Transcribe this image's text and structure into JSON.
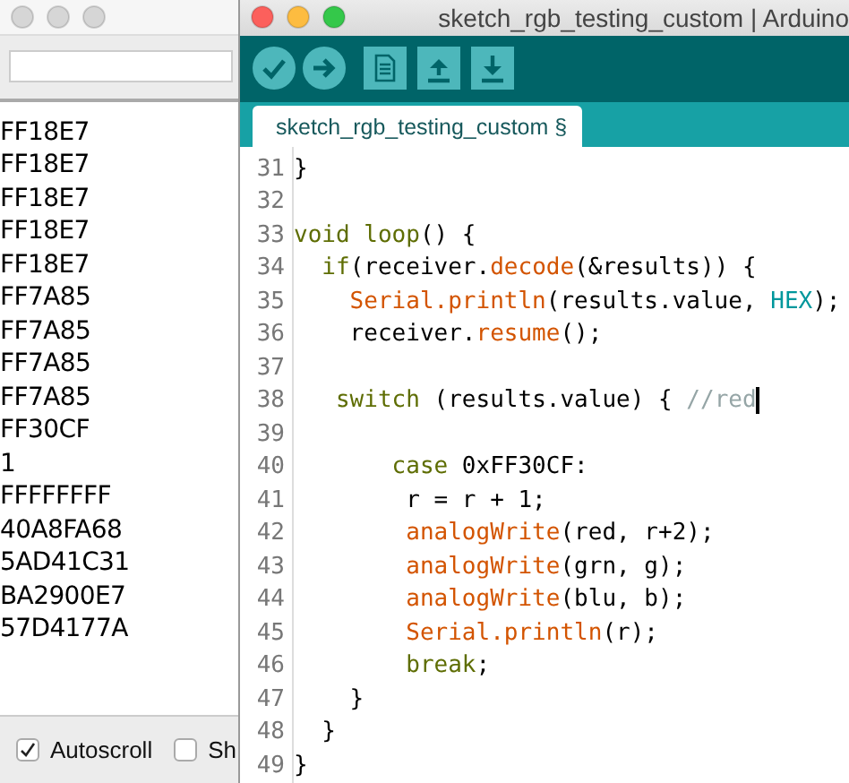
{
  "serial_monitor": {
    "output": [
      "FF18E7",
      "FF18E7",
      "FF18E7",
      "FF18E7",
      "FF18E7",
      "FF7A85",
      "FF7A85",
      "FF7A85",
      "FF7A85",
      "FF30CF",
      "1",
      "FFFFFFFF",
      "40A8FA68",
      "5AD41C31",
      "BA2900E7",
      "57D4177A"
    ],
    "options": [
      {
        "label": "Autoscroll",
        "checked": true
      },
      {
        "label": "Sh",
        "checked": false
      }
    ]
  },
  "ide": {
    "window": {
      "title": "sketch_rgb_testing_custom | Arduino"
    },
    "tabs": [
      {
        "label": "sketch_rgb_testing_custom §",
        "selected": true
      }
    ],
    "lines": [
      {
        "number": "31",
        "cursor": false,
        "segments": [
          {
            "kind": "plain",
            "text": "}"
          }
        ]
      },
      {
        "number": "32",
        "cursor": false
      },
      {
        "number": "33",
        "cursor": false,
        "segments": [
          {
            "kind": "keyword",
            "text": "void loop"
          },
          {
            "kind": "plain",
            "text": "() {"
          }
        ]
      },
      {
        "number": "34",
        "cursor": false,
        "segments": [
          {
            "kind": "keyword",
            "text": "  if"
          },
          {
            "kind": "plain",
            "text": "(receiver."
          },
          {
            "kind": "function",
            "text": "decode"
          },
          {
            "kind": "plain",
            "text": "(&results)) {"
          }
        ]
      },
      {
        "number": "35",
        "cursor": false,
        "segments": [
          {
            "kind": "function",
            "text": "    Serial.println"
          },
          {
            "kind": "plain",
            "text": "(results.value, "
          },
          {
            "kind": "constant",
            "text": "HEX"
          },
          {
            "kind": "plain",
            "text": ");"
          }
        ]
      },
      {
        "number": "36",
        "cursor": false,
        "segments": [
          {
            "kind": "plain",
            "text": "    receiver."
          },
          {
            "kind": "function",
            "text": "resume"
          },
          {
            "kind": "plain",
            "text": "();"
          }
        ]
      },
      {
        "number": "37",
        "cursor": false
      },
      {
        "number": "38",
        "cursor": true,
        "segments": [
          {
            "kind": "keyword",
            "text": "   switch"
          },
          {
            "kind": "plain",
            "text": " (results.value) { "
          },
          {
            "kind": "comment",
            "text": "//red"
          }
        ]
      },
      {
        "number": "39",
        "cursor": false
      },
      {
        "number": "40",
        "cursor": false,
        "segments": [
          {
            "kind": "keyword",
            "text": "       case"
          },
          {
            "kind": "plain",
            "text": " 0xFF30CF:"
          }
        ]
      },
      {
        "number": "41",
        "cursor": false,
        "segments": [
          {
            "kind": "plain",
            "text": "        r = r + 1;"
          }
        ]
      },
      {
        "number": "42",
        "cursor": false,
        "segments": [
          {
            "kind": "function",
            "text": "        analogWrite"
          },
          {
            "kind": "plain",
            "text": "(red, r+2);"
          }
        ]
      },
      {
        "number": "43",
        "cursor": false,
        "segments": [
          {
            "kind": "function",
            "text": "        analogWrite"
          },
          {
            "kind": "plain",
            "text": "(grn, g);"
          }
        ]
      },
      {
        "number": "44",
        "cursor": false,
        "segments": [
          {
            "kind": "function",
            "text": "        analogWrite"
          },
          {
            "kind": "plain",
            "text": "(blu, b);"
          }
        ]
      },
      {
        "number": "45",
        "cursor": false,
        "segments": [
          {
            "kind": "function",
            "text": "        Serial.println"
          },
          {
            "kind": "plain",
            "text": "(r);"
          }
        ]
      },
      {
        "number": "46",
        "cursor": false,
        "segments": [
          {
            "kind": "keyword",
            "text": "        break"
          },
          {
            "kind": "plain",
            "text": ";"
          }
        ]
      },
      {
        "number": "47",
        "cursor": false,
        "segments": [
          {
            "kind": "plain",
            "text": "    }"
          }
        ]
      },
      {
        "number": "48",
        "cursor": false,
        "segments": [
          {
            "kind": "plain",
            "text": "  }"
          }
        ]
      },
      {
        "number": "49",
        "cursor": false,
        "segments": [
          {
            "kind": "plain",
            "text": "}"
          }
        ]
      }
    ]
  }
}
